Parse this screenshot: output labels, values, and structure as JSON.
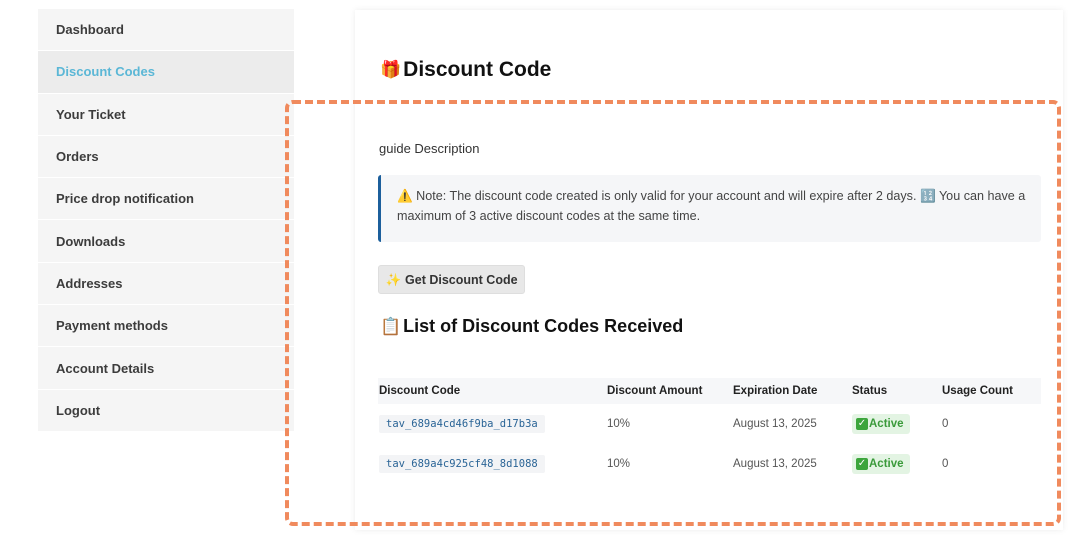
{
  "sidebar": {
    "items": [
      {
        "label": "Dashboard"
      },
      {
        "label": "Discount Codes"
      },
      {
        "label": "Your Ticket"
      },
      {
        "label": "Orders"
      },
      {
        "label": "Price drop notification"
      },
      {
        "label": "Downloads"
      },
      {
        "label": "Addresses"
      },
      {
        "label": "Payment methods"
      },
      {
        "label": "Account Details"
      },
      {
        "label": "Logout"
      }
    ],
    "active_index": 1
  },
  "main": {
    "title_icon": "🎁",
    "title": "Discount Code",
    "guide": "guide Description",
    "note": {
      "warn_icon": "⚠️",
      "text1": " Note: The discount code created is only valid for your account and will expire after 2 days. ",
      "num_icon": "🔢",
      "text2": " You can have a maximum of 3 active discount codes at the same time."
    },
    "button": {
      "icon": "✨",
      "label": "Get Discount Code"
    },
    "list_icon": "📋",
    "list_title": "List of Discount Codes Received",
    "table": {
      "headers": [
        "Discount Code",
        "Discount Amount",
        "Expiration Date",
        "Status",
        "Usage Count"
      ],
      "rows": [
        {
          "code": "tav_689a4cd46f9ba_d17b3a",
          "amount": "10%",
          "expiration": "August 13, 2025",
          "status": "Active",
          "usage": "0"
        },
        {
          "code": "tav_689a4c925cf48_8d1088",
          "amount": "10%",
          "expiration": "August 13, 2025",
          "status": "Active",
          "usage": "0"
        }
      ]
    }
  },
  "colors": {
    "accent": "#5bb7d6",
    "highlight_border": "#f08a5d",
    "note_border": "#1c5f9c",
    "status_active": "#3a9a3a"
  }
}
